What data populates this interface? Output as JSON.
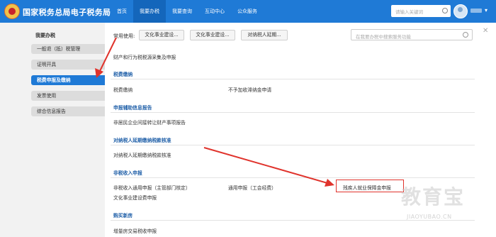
{
  "header": {
    "brand": "国家税务总局电子税务局",
    "nav": [
      "首页",
      "我要办税",
      "我要查询",
      "互动中心",
      "公众服务"
    ],
    "active_nav_index": 1,
    "search_placeholder": "请输入关键词"
  },
  "sidebar": {
    "title": "我要办税",
    "items": [
      "一般退（抵）税管理",
      "证明开具",
      "税费申报及缴纳",
      "发票使用",
      "综合信息报告"
    ],
    "active_index": 2
  },
  "content": {
    "common_label": "常用使用:",
    "common_buttons": [
      "文化事业建设...",
      "文化事业建设...",
      "对纳税人延期..."
    ],
    "service_search_placeholder": "在我要办税中搜索服务功能",
    "top_link": "财产和行为税税源采集及申报",
    "sections": [
      {
        "title": "税费缴纳",
        "links": [
          "税费缴纳",
          "不予加收滞纳金申请"
        ]
      },
      {
        "title": "申报辅助信息报告",
        "links": [
          "非居民企业间接转让财产事项报告"
        ]
      },
      {
        "title": "对纳税人延期缴纳税款核准",
        "links": [
          "对纳税人延期缴纳税款核准"
        ]
      },
      {
        "title": "非税收入申报",
        "links": [
          "非税收入通用申报（主管部门核定）",
          "通用申报（工会经费）",
          "残疾人就业保障金申报",
          "文化事业建设费申报"
        ]
      },
      {
        "title": "购买新房",
        "links": [
          "增量房交易税收申报"
        ]
      }
    ]
  },
  "watermark": {
    "main": "教育宝",
    "sub": "JIAOYUBAO.CN"
  },
  "colors": {
    "header_bg": "#1f7ad6",
    "active_sidebar": "#1f7ad6",
    "section_title": "#1f5fa8",
    "annotation_red": "#e0332c"
  }
}
